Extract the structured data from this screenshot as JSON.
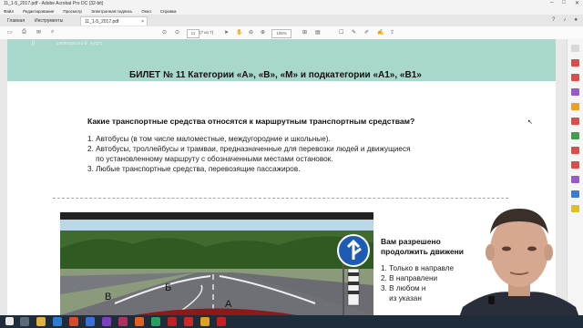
{
  "window": {
    "title": "11_1-5_2017.pdf - Adobe Acrobat Pro DC (32-bit)",
    "controls": [
      "–",
      "□",
      "✕"
    ]
  },
  "menu": [
    "Файл",
    "Редактирование",
    "Просмотр",
    "Электронная подпись",
    "Окно",
    "Справка"
  ],
  "tabs": {
    "home": "Главная",
    "tools": "Инструменты",
    "doc": "11_1-5_2017.pdf",
    "doc_close": "×"
  },
  "toolbar": {
    "page": "11",
    "page_count": "(7 из 7)",
    "zoom": "106%"
  },
  "document": {
    "banner_subtitle": "авторский курс",
    "ticket_title": "БИЛЕТ № 11  Категории «А», «В», «М» и подкатегории «А1», «В1»",
    "question": "Какие транспортные средства относятся к маршрутным транспортным средствам?",
    "answers": [
      "1. Автобусы (в том числе маломестные, междугородние и школьные).",
      "2. Автобусы, троллейбусы и трамваи, предназначенные для перевозки людей и движущиеся",
      "    по установленному маршруту с обозначенными местами остановок.",
      "3. Любые транспортные средства, перевозящие пассажиров."
    ],
    "photo_labels": {
      "a": "А",
      "b": "Б",
      "v": "В"
    },
    "question2_lines": [
      "Вам разрешено",
      "продолжить движени"
    ],
    "answers2": [
      "1. Только в направле",
      "2. В направлени",
      "3. В любом н",
      "    из указан"
    ]
  },
  "colors": {
    "banner": "#a8d8cc",
    "taskbar": "#1f2d3a",
    "sign_blue": "#1e5bb5"
  }
}
